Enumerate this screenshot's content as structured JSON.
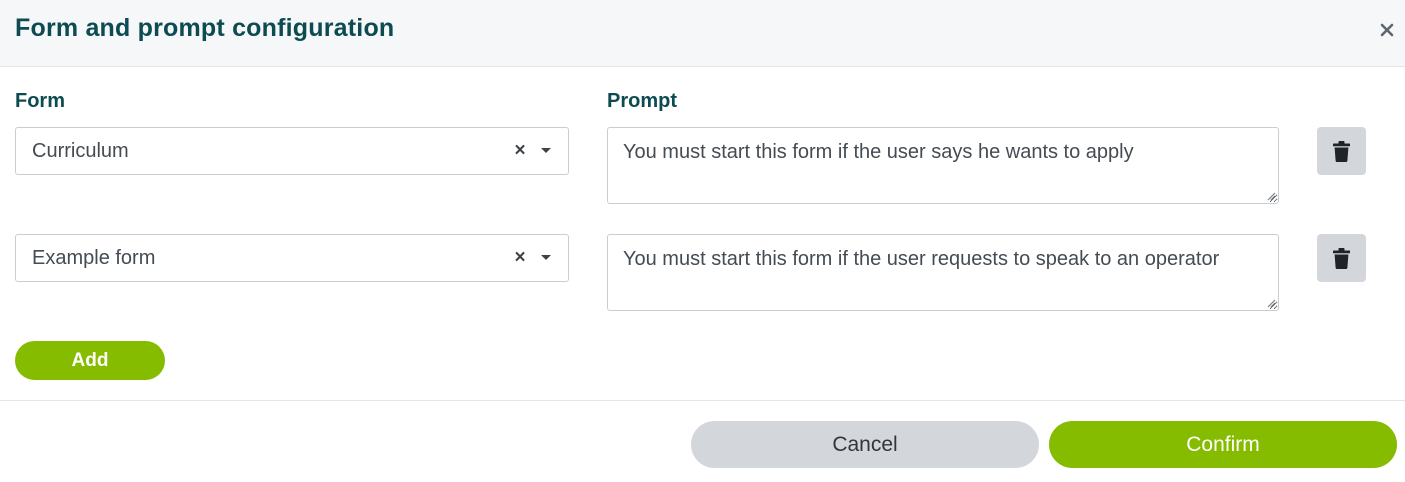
{
  "dialog": {
    "title": "Form and prompt configuration",
    "close_icon": "close-icon"
  },
  "columns": {
    "form_label": "Form",
    "prompt_label": "Prompt"
  },
  "rows": [
    {
      "form": "Curriculum",
      "prompt": "You must start this form if the user says he wants to apply"
    },
    {
      "form": "Example form",
      "prompt": "You must start this form if the user requests to speak to an operator"
    }
  ],
  "icons": {
    "clear": "×",
    "caret": "chevron-down-icon",
    "delete": "trash-icon"
  },
  "actions": {
    "add_label": "Add",
    "cancel_label": "Cancel",
    "confirm_label": "Confirm"
  },
  "colors": {
    "title": "#0d4b52",
    "accent": "#86bc00",
    "secondary_button": "#d3d7dc"
  }
}
